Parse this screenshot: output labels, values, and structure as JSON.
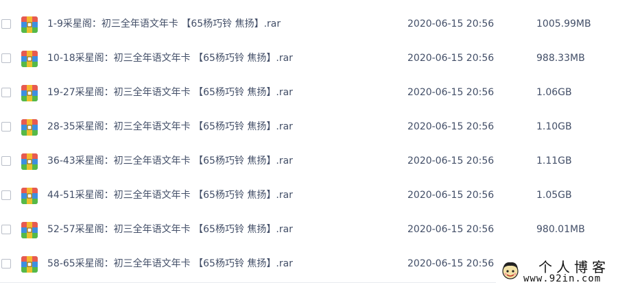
{
  "files": [
    {
      "name": "1-9采星阁：初三全年语文年卡 【65杨巧铃 焦扬】.rar",
      "date": "2020-06-15 20:56",
      "size": "1005.99MB"
    },
    {
      "name": "10-18采星阁：初三全年语文年卡 【65杨巧铃 焦扬】.rar",
      "date": "2020-06-15 20:56",
      "size": "988.33MB"
    },
    {
      "name": "19-27采星阁：初三全年语文年卡 【65杨巧铃 焦扬】.rar",
      "date": "2020-06-15 20:56",
      "size": "1.06GB"
    },
    {
      "name": "28-35采星阁：初三全年语文年卡 【65杨巧铃 焦扬】.rar",
      "date": "2020-06-15 20:56",
      "size": "1.10GB"
    },
    {
      "name": "36-43采星阁：初三全年语文年卡 【65杨巧铃 焦扬】.rar",
      "date": "2020-06-15 20:56",
      "size": "1.11GB"
    },
    {
      "name": "44-51采星阁：初三全年语文年卡 【65杨巧铃 焦扬】.rar",
      "date": "2020-06-15 20:56",
      "size": "1.05GB"
    },
    {
      "name": "52-57采星阁：初三全年语文年卡 【65杨巧铃 焦扬】.rar",
      "date": "2020-06-15 20:56",
      "size": "980.01MB"
    },
    {
      "name": "58-65采星阁：初三全年语文年卡 【65杨巧铃 焦扬】.rar",
      "date": "2020-06-15 20:56",
      "size": ""
    }
  ],
  "icons": {
    "file": "rar-archive-icon",
    "checkbox": "checkbox"
  },
  "colors": {
    "text": "#424e67",
    "icon_red": "#e85a4f",
    "icon_blue": "#3d8fe0",
    "icon_green": "#56b947",
    "icon_yellow": "#f5c02c"
  },
  "watermark": {
    "title": "个人博客",
    "url": "www.92in.com"
  }
}
